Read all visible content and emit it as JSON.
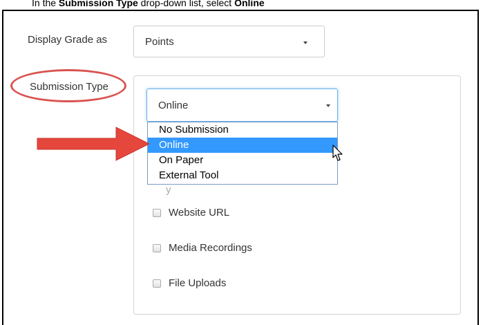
{
  "instruction": {
    "prefix": "In the ",
    "field_name": "Submission Type",
    "middle": " drop-down list, select ",
    "option": "Online"
  },
  "grade": {
    "label": "Display Grade as",
    "value": "Points"
  },
  "submission": {
    "label": "Submission Type",
    "value": "Online",
    "options": [
      "No Submission",
      "Online",
      "On Paper",
      "External Tool"
    ],
    "selected_index": 1,
    "partially_hidden_text": "y"
  },
  "online_options": {
    "items": [
      "Website URL",
      "Media Recordings",
      "File Uploads"
    ]
  },
  "colors": {
    "highlight": "#d9534f",
    "arrow": "#e5473c",
    "selected_option": "#3399ff"
  }
}
